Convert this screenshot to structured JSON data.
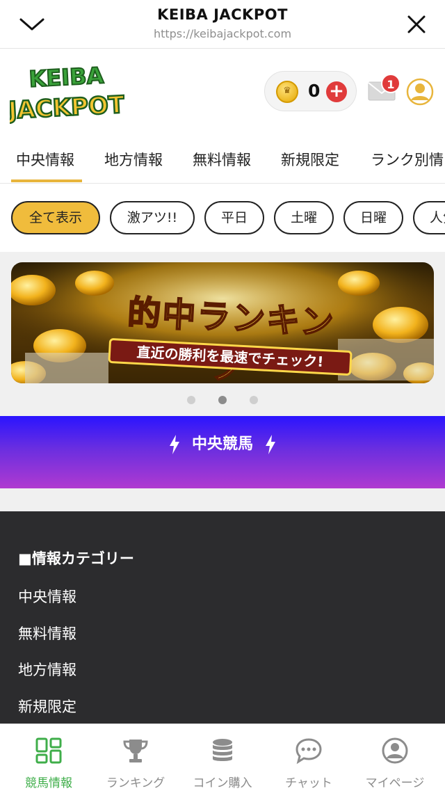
{
  "browser": {
    "title": "KEIBA JACKPOT",
    "url": "https://keibajackpot.com"
  },
  "header": {
    "logo_text": "KEIBA JACKPOT",
    "coin_count": "0",
    "unread_badge": "1"
  },
  "tabs": [
    "中央情報",
    "地方情報",
    "無料情報",
    "新規限定",
    "ランク別情"
  ],
  "filters": [
    "全て表示",
    "激アツ!!",
    "平日",
    "土曜",
    "日曜",
    "人気"
  ],
  "banner": {
    "title": "的中ランキング",
    "subtitle": "直近の勝利を最速でチェック!",
    "slide_count": 3,
    "active_slide": 2
  },
  "section": {
    "title": "中央競馬"
  },
  "footer": {
    "heading": "■情報カテゴリー",
    "links": [
      "中央情報",
      "無料情報",
      "地方情報",
      "新規限定"
    ]
  },
  "bottom_nav": [
    {
      "label": "競馬情報",
      "icon": "grid-icon"
    },
    {
      "label": "ランキング",
      "icon": "trophy-icon"
    },
    {
      "label": "コイン購入",
      "icon": "coins-icon"
    },
    {
      "label": "チャット",
      "icon": "chat-icon"
    },
    {
      "label": "マイページ",
      "icon": "user-icon"
    }
  ],
  "colors": {
    "accent": "#f0bc3c",
    "active_nav": "#3fae4a",
    "badge": "#e03b3b",
    "footer_bg": "#2c2c2e"
  }
}
